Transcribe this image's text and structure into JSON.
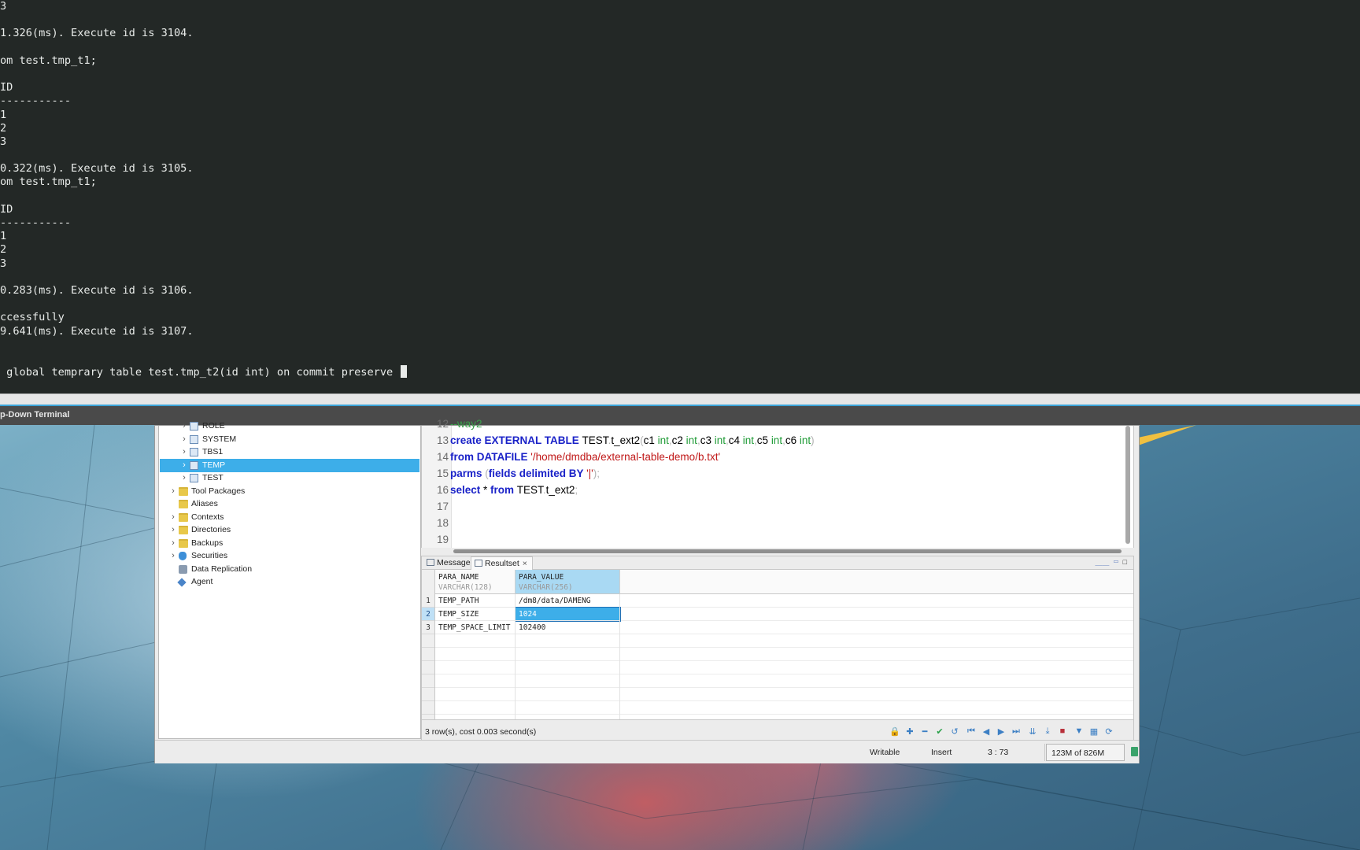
{
  "terminal": {
    "title": "p-Down Terminal",
    "lines": [
      "3",
      "",
      "1.326(ms). Execute id is 3104.",
      "",
      "om test.tmp_t1;",
      "",
      "ID",
      "-----------",
      "1",
      "2",
      "3",
      "",
      "0.322(ms). Execute id is 3105.",
      "om test.tmp_t1;",
      "",
      "ID",
      "-----------",
      "1",
      "2",
      "3",
      "",
      "0.283(ms). Execute id is 3106.",
      "",
      "ccessfully",
      "9.641(ms). Execute id is 3107.",
      "",
      "",
      " global temprary table test.tmp_t2(id int) on commit preserve "
    ]
  },
  "tree": {
    "items": [
      {
        "label": "ROLE",
        "icon": "tablespace-icon"
      },
      {
        "label": "SYSTEM",
        "icon": "tablespace-icon"
      },
      {
        "label": "TBS1",
        "icon": "tablespace-icon"
      },
      {
        "label": "TEMP",
        "icon": "tablespace-icon"
      },
      {
        "label": "TEST",
        "icon": "tablespace-icon"
      },
      {
        "label": "Tool Packages",
        "icon": "folder-icon"
      },
      {
        "label": "Aliases",
        "icon": "folder-icon"
      },
      {
        "label": "Contexts",
        "icon": "folder-icon"
      },
      {
        "label": "Directories",
        "icon": "folder-icon"
      },
      {
        "label": "Backups",
        "icon": "folder-icon"
      },
      {
        "label": "Securities",
        "icon": "shield-icon"
      },
      {
        "label": "Data Replication",
        "icon": "replication-icon"
      },
      {
        "label": "Agent",
        "icon": "agent-icon"
      }
    ],
    "selected": "TEMP"
  },
  "editor": {
    "partial_line": {
      "num": "12",
      "text": "--way2"
    },
    "lines": [
      {
        "num": "13",
        "parts": [
          [
            "kw",
            "create EXTERNAL TABLE "
          ],
          [
            "",
            ""
          ],
          [
            "",
            "TEST"
          ],
          [
            "pun",
            "."
          ],
          [
            "",
            "t_ext2"
          ],
          [
            "pun",
            "("
          ],
          [
            "",
            "c1 "
          ],
          [
            "ty",
            "int"
          ],
          [
            "pun",
            ","
          ],
          [
            "",
            "c2 "
          ],
          [
            "ty",
            "int"
          ],
          [
            "pun",
            ","
          ],
          [
            "",
            "c3 "
          ],
          [
            "ty",
            "int"
          ],
          [
            "pun",
            ","
          ],
          [
            "",
            "c4 "
          ],
          [
            "ty",
            "int"
          ],
          [
            "pun",
            ","
          ],
          [
            "",
            "c5 "
          ],
          [
            "ty",
            "int"
          ],
          [
            "pun",
            ","
          ],
          [
            "",
            "c6 "
          ],
          [
            "ty",
            "int"
          ],
          [
            "pun",
            ")"
          ]
        ]
      },
      {
        "num": "14",
        "parts": [
          [
            "kw",
            "from DATAFILE "
          ],
          [
            "str",
            "'/home/dmdba/external-table-demo/b.txt'"
          ]
        ]
      },
      {
        "num": "15",
        "parts": [
          [
            "kw",
            "parms "
          ],
          [
            "pun",
            "("
          ],
          [
            "kw",
            "fields delimited BY "
          ],
          [
            "str",
            "'|'"
          ],
          [
            "pun",
            ");"
          ]
        ]
      },
      {
        "num": "16",
        "parts": [
          [
            "kw",
            "select "
          ],
          [
            "",
            "* "
          ],
          [
            "kw",
            "from "
          ],
          [
            "",
            "TEST"
          ],
          [
            "pun",
            "."
          ],
          [
            "",
            "t_ext2"
          ],
          [
            "pun",
            ";"
          ]
        ]
      },
      {
        "num": "17",
        "parts": []
      },
      {
        "num": "18",
        "parts": []
      },
      {
        "num": "19",
        "parts": []
      }
    ]
  },
  "result_tabs": {
    "message_label": "Message",
    "resultset_label": "Resultset",
    "close_glyph": "×"
  },
  "grid": {
    "columns": [
      {
        "name": "PARA_NAME",
        "type": "VARCHAR(128)"
      },
      {
        "name": "PARA_VALUE",
        "type": "VARCHAR(256)"
      }
    ],
    "rows": [
      {
        "n": "1",
        "cells": [
          "TEMP_PATH",
          "/dm8/data/DAMENG"
        ]
      },
      {
        "n": "2",
        "cells": [
          "TEMP_SIZE",
          "1024"
        ]
      },
      {
        "n": "3",
        "cells": [
          "TEMP_SPACE_LIMIT",
          "102400"
        ]
      }
    ],
    "summary": "3 row(s), cost 0.003 second(s)"
  },
  "statusbar": {
    "mode": "Writable",
    "insert": "Insert",
    "position": "3 : 73",
    "memory": "123M of 826M"
  },
  "colors": {
    "terminal_bg": "#232826",
    "selection": "#3daee9",
    "keyword": "#1a22c8",
    "type": "#1f9b36",
    "string": "#c01818"
  }
}
